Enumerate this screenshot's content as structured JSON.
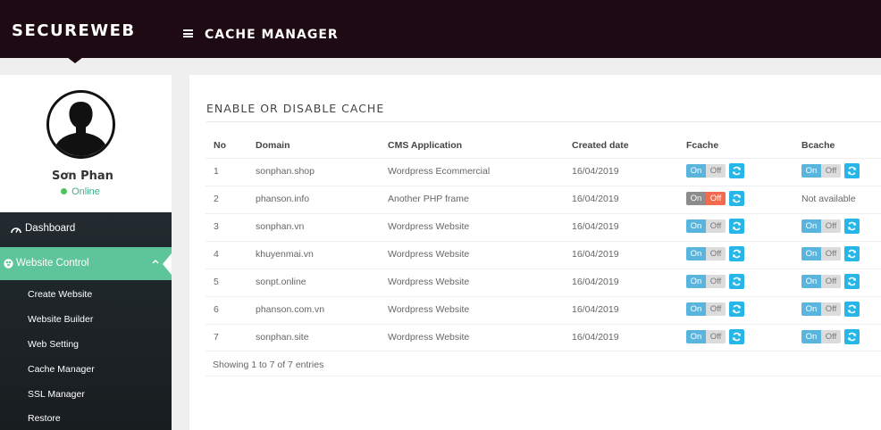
{
  "brand": "SECUREWEB",
  "header": {
    "title": "CACHE MANAGER",
    "menu_icon": "hamburger-icon"
  },
  "profile": {
    "name": "Sơn Phan",
    "status": "Online",
    "avatar_icon": "user-silhouette-icon"
  },
  "sidebar": {
    "dashboard": {
      "label": "Dashboard",
      "icon": "gauge-icon"
    },
    "website_control": {
      "label": "Website Control",
      "icon": "cubes-icon",
      "expanded": true,
      "color": "#5ec49a"
    },
    "sub_items": [
      "Create Website",
      "Website Builder",
      "Web Setting",
      "Cache Manager",
      "SSL Manager",
      "Restore"
    ]
  },
  "panel": {
    "title": "ENABLE OR DISABLE CACHE",
    "columns": {
      "no": "No",
      "domain": "Domain",
      "cms": "CMS Application",
      "created": "Created date",
      "fcache": "Fcache",
      "bcache": "Bcache"
    },
    "toggle_labels": {
      "on": "On",
      "off": "Off"
    },
    "rows": [
      {
        "no": "1",
        "domain": "sonphan.shop",
        "cms": "Wordpress Ecommercial",
        "created": "16/04/2019",
        "fcache": "on",
        "bcache": "on"
      },
      {
        "no": "2",
        "domain": "phanson.info",
        "cms": "Another PHP frame",
        "created": "16/04/2019",
        "fcache": "off",
        "bcache": "Not available"
      },
      {
        "no": "3",
        "domain": "sonphan.vn",
        "cms": "Wordpress Website",
        "created": "16/04/2019",
        "fcache": "on",
        "bcache": "on"
      },
      {
        "no": "4",
        "domain": "khuyenmai.vn",
        "cms": "Wordpress Website",
        "created": "16/04/2019",
        "fcache": "on",
        "bcache": "on"
      },
      {
        "no": "5",
        "domain": "sonpt.online",
        "cms": "Wordpress Website",
        "created": "16/04/2019",
        "fcache": "on",
        "bcache": "on"
      },
      {
        "no": "6",
        "domain": "phanson.com.vn",
        "cms": "Wordpress Website",
        "created": "16/04/2019",
        "fcache": "on",
        "bcache": "on"
      },
      {
        "no": "7",
        "domain": "sonphan.site",
        "cms": "Wordpress Website",
        "created": "16/04/2019",
        "fcache": "on",
        "bcache": "on"
      }
    ],
    "footer": "Showing 1 to 7 of 7 entries"
  },
  "colors": {
    "topbar": "#1e0a12",
    "accent_green": "#5ec49a",
    "toggle_on": "#5ab5de",
    "toggle_off_active": "#f26b4f",
    "refresh": "#27b6e8"
  }
}
